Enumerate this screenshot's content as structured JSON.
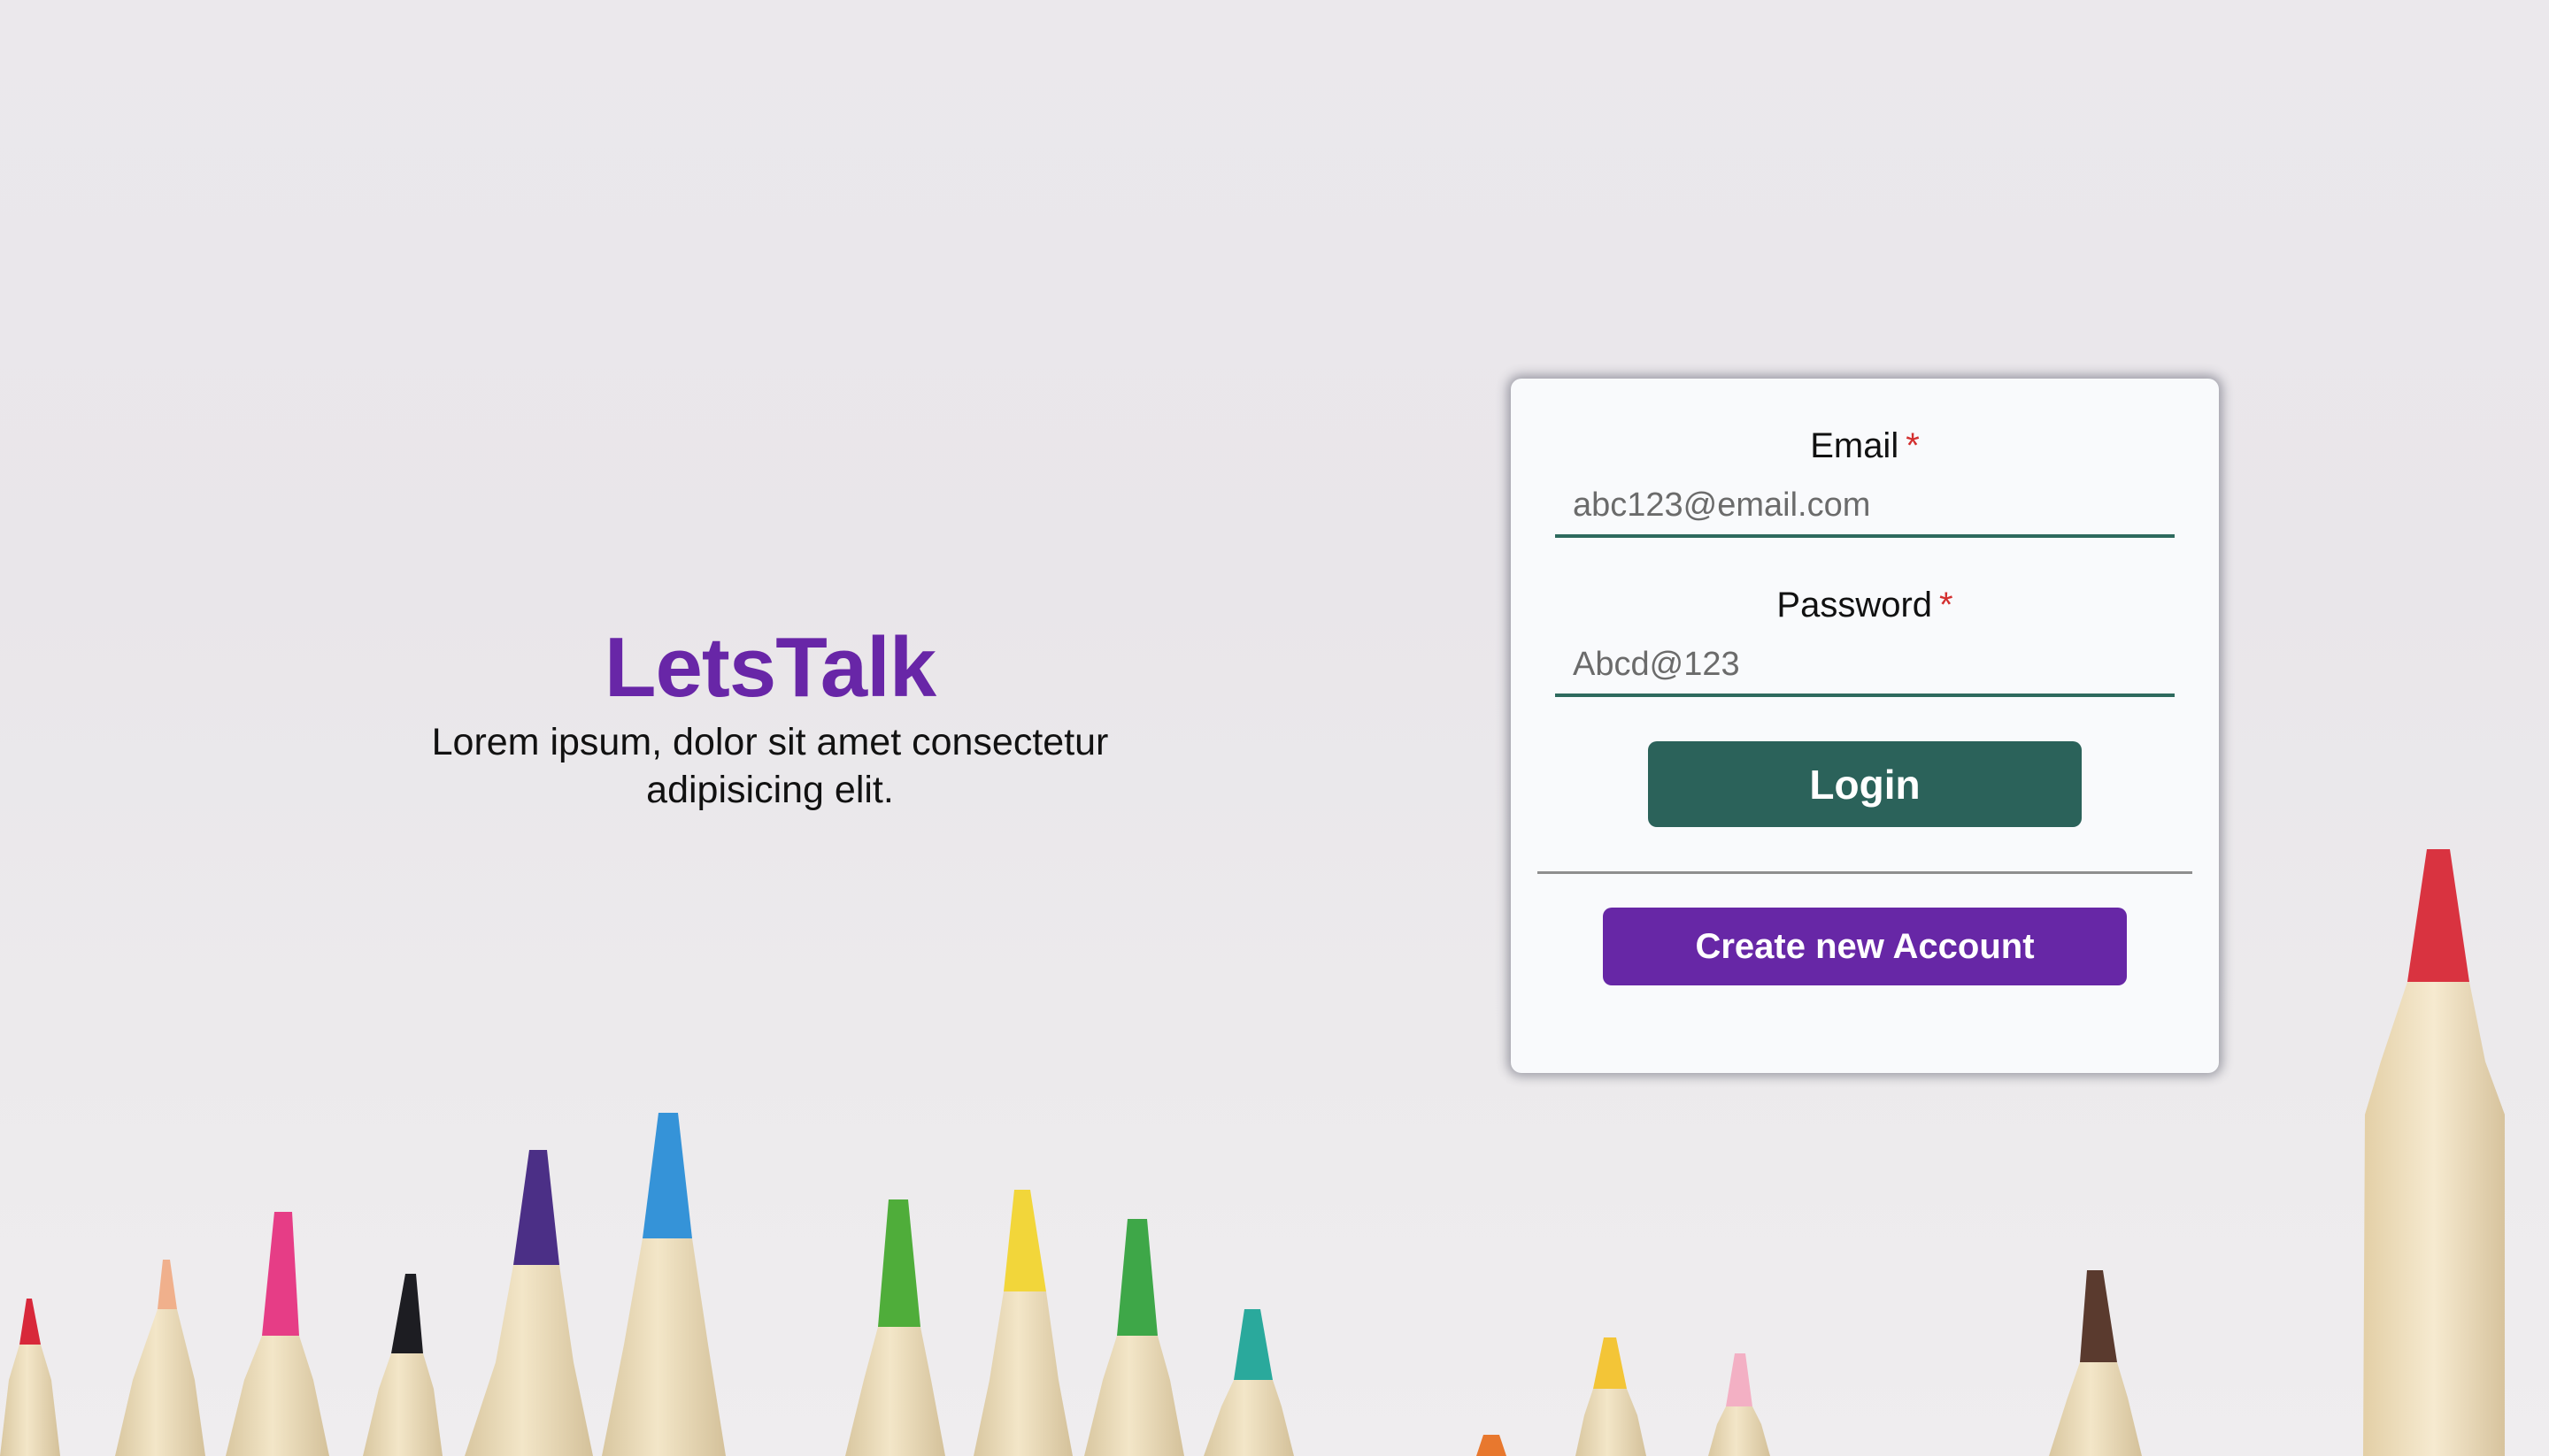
{
  "brand": {
    "title": "LetsTalk",
    "tagline": "Lorem ipsum, dolor sit amet consectetur adipisicing elit."
  },
  "login_form": {
    "email": {
      "label": "Email",
      "required_mark": "*",
      "value": "abc123@email.com"
    },
    "password": {
      "label": "Password",
      "required_mark": "*",
      "value": "Abcd@123"
    },
    "login_label": "Login",
    "create_account_label": "Create new Account"
  },
  "colors": {
    "brand_purple": "#6826a7",
    "login_green": "#2b625a",
    "input_underline": "#2e6a5e",
    "required_red": "#d32f2f",
    "card_background": "#f9fafc",
    "page_background": "#ebe8ec"
  },
  "background_image": {
    "subject": "colored-pencil-tips",
    "pencil_colors": [
      "#d8283a",
      "#f0b08c",
      "#e63d86",
      "#1d1d22",
      "#4b2f86",
      "#3593d8",
      "#4fad3a",
      "#f2d63a",
      "#3ea748",
      "#2aa99c",
      "#e8782e",
      "#f3c537",
      "#f3b0c4",
      "#5a3a2e",
      "#d93340"
    ]
  }
}
